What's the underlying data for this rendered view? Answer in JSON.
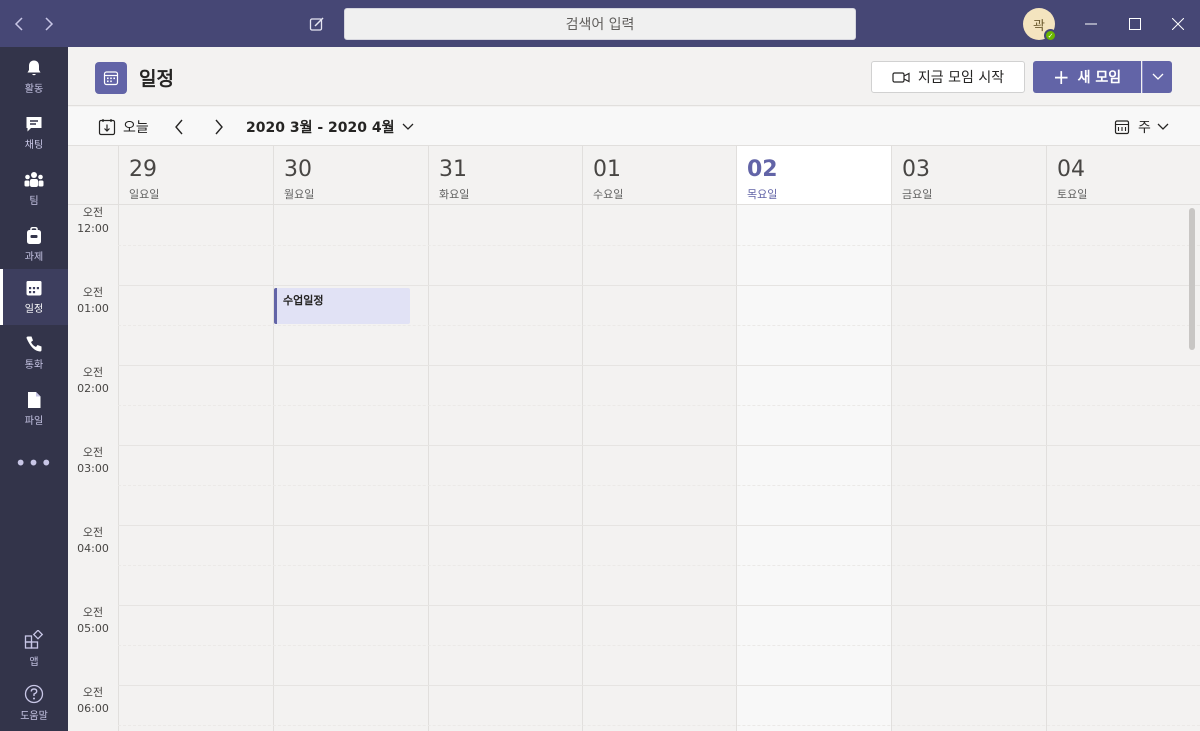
{
  "titlebar": {
    "search_placeholder": "검색어 입력",
    "avatar_initial": "곽"
  },
  "rail": {
    "items": [
      {
        "label": "활동",
        "icon": "bell-icon"
      },
      {
        "label": "채팅",
        "icon": "chat-icon"
      },
      {
        "label": "팀",
        "icon": "teams-icon"
      },
      {
        "label": "과제",
        "icon": "assignments-icon"
      },
      {
        "label": "일정",
        "icon": "calendar-icon",
        "active": true
      },
      {
        "label": "통화",
        "icon": "phone-icon"
      },
      {
        "label": "파일",
        "icon": "file-icon"
      }
    ],
    "more": "•••",
    "apps_label": "앱",
    "help_label": "도움말"
  },
  "header": {
    "title": "일정",
    "meet_now": "지금 모임 시작",
    "new_meeting": "새 모임"
  },
  "toolbar": {
    "today": "오늘",
    "range": "2020 3월 - 2020 4월",
    "view": "주"
  },
  "days": [
    {
      "num": "29",
      "name": "일요일"
    },
    {
      "num": "30",
      "name": "월요일"
    },
    {
      "num": "31",
      "name": "화요일"
    },
    {
      "num": "01",
      "name": "수요일"
    },
    {
      "num": "02",
      "name": "목요일",
      "today": true
    },
    {
      "num": "03",
      "name": "금요일"
    },
    {
      "num": "04",
      "name": "토요일"
    }
  ],
  "times": [
    {
      "ampm": "오전",
      "time": "12:00"
    },
    {
      "ampm": "오전",
      "time": "01:00"
    },
    {
      "ampm": "오전",
      "time": "02:00"
    },
    {
      "ampm": "오전",
      "time": "03:00"
    },
    {
      "ampm": "오전",
      "time": "04:00"
    },
    {
      "ampm": "오전",
      "time": "05:00"
    },
    {
      "ampm": "오전",
      "time": "06:00"
    }
  ],
  "events": [
    {
      "title": "수업일정",
      "day": "30",
      "start": "01:00"
    }
  ],
  "colors": {
    "accent": "#6264a7",
    "titlebar": "#464775",
    "rail": "#33344a",
    "presence": "#6bb700"
  }
}
